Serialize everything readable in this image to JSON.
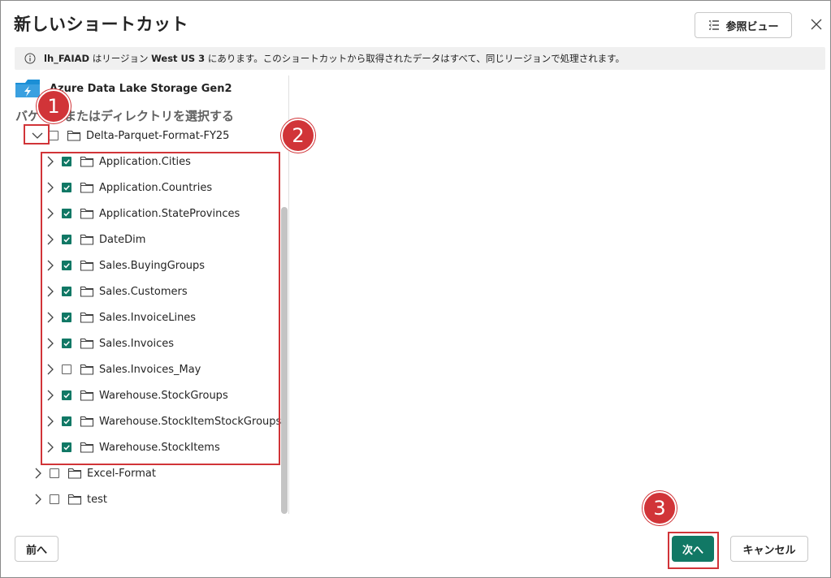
{
  "dialog": {
    "title": "新しいショートカット",
    "ref_view_label": "参照ビュー"
  },
  "info_bar": {
    "lakehouse": "lh_FAIAD",
    "text_1": " はリージョン ",
    "region": "West US 3",
    "text_2": " にあります。このショートカットから取得されたデータはすべて、同じリージョンで処理されます。"
  },
  "source": {
    "label": "Azure Data Lake Storage Gen2"
  },
  "section_title": "バケットまたはディレクトリを選択する",
  "tree": {
    "root": {
      "label": "Delta-Parquet-Format-FY25",
      "expanded": true,
      "checked": false
    },
    "children": [
      {
        "label": "Application.Cities",
        "checked": true
      },
      {
        "label": "Application.Countries",
        "checked": true
      },
      {
        "label": "Application.StateProvinces",
        "checked": true
      },
      {
        "label": "DateDim",
        "checked": true
      },
      {
        "label": "Sales.BuyingGroups",
        "checked": true
      },
      {
        "label": "Sales.Customers",
        "checked": true
      },
      {
        "label": "Sales.InvoiceLines",
        "checked": true
      },
      {
        "label": "Sales.Invoices",
        "checked": true
      },
      {
        "label": "Sales.Invoices_May",
        "checked": false
      },
      {
        "label": "Warehouse.StockGroups",
        "checked": true
      },
      {
        "label": "Warehouse.StockItemStockGroups",
        "checked": true
      },
      {
        "label": "Warehouse.StockItems",
        "checked": true
      }
    ],
    "siblings": [
      {
        "label": "Excel-Format",
        "checked": false
      },
      {
        "label": "test",
        "checked": false
      }
    ]
  },
  "annotations": [
    "1",
    "2",
    "3"
  ],
  "footer": {
    "back_label": "前へ",
    "next_label": "次へ",
    "cancel_label": "キャンセル"
  },
  "colors": {
    "accent": "#117865",
    "annotation": "#d13438"
  }
}
